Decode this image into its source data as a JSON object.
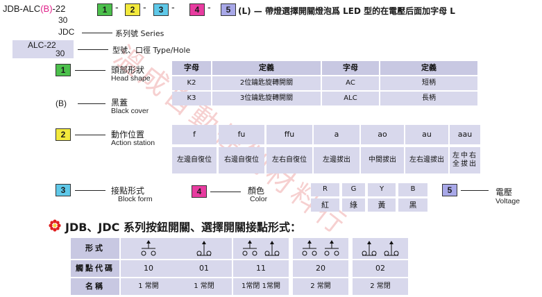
{
  "title": {
    "prefix": "JDB-ALC",
    "b": "(B)",
    "suffix": "-22",
    "b1": "1",
    "b2": "2",
    "b3": "3",
    "b4": "4",
    "b5": "5",
    "dash": "-",
    "tail": "(L) — 帶燈選擇開關燈泡爲 LED 型的在電壓后面加字母 L",
    "sub30": "30"
  },
  "series": {
    "code": "JDC",
    "label": "系列號 Series"
  },
  "type_hole": {
    "code1": "ALC-22",
    "code2": "30",
    "label": "型號、口徑 Type/Hole"
  },
  "head": {
    "num": "1",
    "zh": "頭部形狀",
    "en": "Head shape",
    "cols": [
      "字母",
      "定義",
      "字母",
      "定義"
    ],
    "rows": [
      [
        "K2",
        "2位鑰匙旋轉開關",
        "AC",
        "短柄"
      ],
      [
        "K3",
        "3位鑰匙旋轉開關",
        "ALC",
        "長柄"
      ]
    ]
  },
  "black": {
    "code": "(B)",
    "zh": "黑蓋",
    "en": "Black cover"
  },
  "action": {
    "num": "2",
    "zh": "動作位置",
    "en": "Action station",
    "codes": [
      "f",
      "fu",
      "ffu",
      "a",
      "ao",
      "au",
      "aau"
    ],
    "desc": [
      "左邊自復位",
      "右邊自復位",
      "左右自復位",
      "左邊拔出",
      "中間拔出",
      "左右邊拔出",
      "左中右全拔出"
    ]
  },
  "block": {
    "num": "3",
    "zh": "接點形式",
    "en": "Block form"
  },
  "color": {
    "num": "4",
    "zh": "顏色",
    "en": "Color",
    "codes": [
      "R",
      "G",
      "Y",
      "B"
    ],
    "names": [
      "紅",
      "綠",
      "黃",
      "黑"
    ]
  },
  "voltage": {
    "num": "5",
    "zh": "電壓",
    "en": "Voltage"
  },
  "contact": {
    "heading": "JDB、JDC 系列按鈕開關、選擇開關接點形式：",
    "row_labels": [
      "形式",
      "觸點代碼",
      "名稱"
    ],
    "codes": [
      "10",
      "01",
      "11",
      "20",
      "02"
    ],
    "names": [
      "1 常開",
      "1 常閉",
      "1常閉 1常開",
      "2 常開",
      "2 常閉"
    ]
  },
  "watermark": "溫成自動控制材料行",
  "colors": {
    "green": "#4cc04c",
    "yellow": "#f2e93c",
    "cyan": "#5fc8e8",
    "magenta": "#e83ca0",
    "violet": "#a8a8e8",
    "cell": "#d8d8ec"
  }
}
